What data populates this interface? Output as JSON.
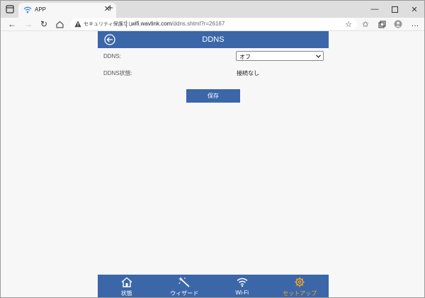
{
  "browser": {
    "tab_title": "APP",
    "security_text": "セキュリティ保護なし",
    "url_host": "wifi.wavlink.com",
    "url_path": "/ddns.shtml?r=26167"
  },
  "page": {
    "title": "DDNS",
    "ddns_label": "DDNS:",
    "ddns_value": "オフ",
    "status_label": "DDNS状態:",
    "status_value": "接続なし",
    "save_label": "保存"
  },
  "bottom_nav": {
    "items": [
      {
        "label": "状態",
        "icon": "home-icon"
      },
      {
        "label": "ウィザード",
        "icon": "magic-wand-icon"
      },
      {
        "label": "Wi-Fi",
        "icon": "wifi-icon"
      },
      {
        "label": "セットアップ",
        "icon": "gear-icon",
        "active": true
      }
    ],
    "active_color": "#f5a623"
  },
  "colors": {
    "primary": "#3b67a9"
  }
}
